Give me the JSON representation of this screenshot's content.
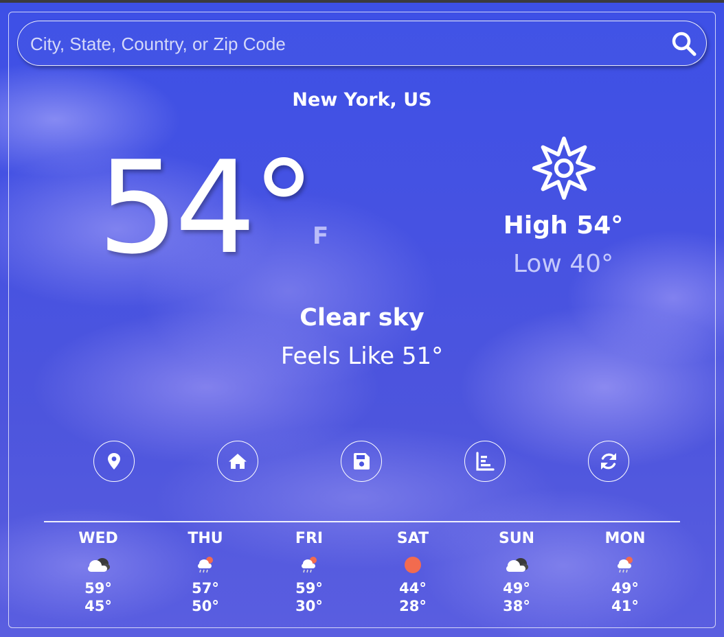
{
  "search": {
    "placeholder": "City, State, Country, or Zip Code",
    "icon": "search-icon"
  },
  "current": {
    "location": "New York, US",
    "temperature": "54°",
    "unit": "F",
    "icon": "sun-icon",
    "high": "High 54°",
    "low": "Low 40°",
    "condition": "Clear sky",
    "feels_like": "Feels Like 51°"
  },
  "actions": [
    {
      "name": "location",
      "icon": "map-pin-icon"
    },
    {
      "name": "home",
      "icon": "home-icon"
    },
    {
      "name": "save",
      "icon": "save-icon"
    },
    {
      "name": "chart",
      "icon": "chart-icon"
    },
    {
      "name": "refresh",
      "icon": "refresh-icon"
    }
  ],
  "forecast": [
    {
      "day": "WED",
      "icon": "cloud-icon",
      "high": "59°",
      "low": "45°"
    },
    {
      "day": "THU",
      "icon": "rain-icon",
      "high": "57°",
      "low": "50°"
    },
    {
      "day": "FRI",
      "icon": "rain-icon",
      "high": "59°",
      "low": "30°"
    },
    {
      "day": "SAT",
      "icon": "sun-icon",
      "high": "44°",
      "low": "28°"
    },
    {
      "day": "SUN",
      "icon": "cloud-icon",
      "high": "49°",
      "low": "38°"
    },
    {
      "day": "MON",
      "icon": "rain-icon",
      "high": "49°",
      "low": "41°"
    }
  ],
  "colors": {
    "sky": "#4652e2",
    "text": "#ffffff",
    "sun_orange": "#f26b4f"
  }
}
